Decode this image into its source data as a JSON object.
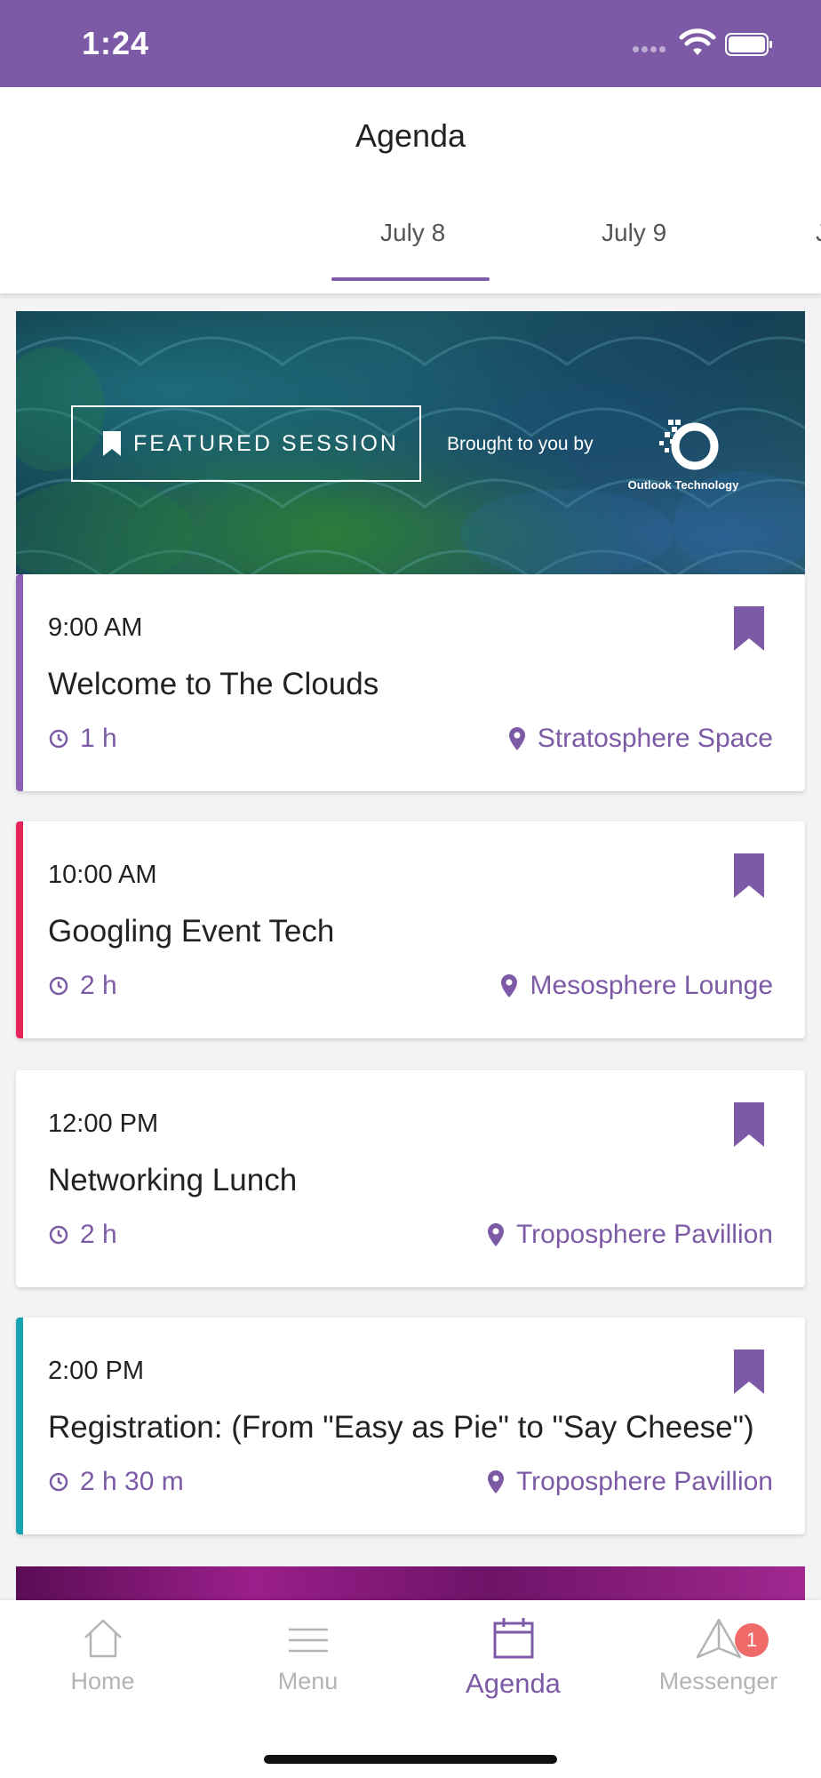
{
  "status_bar": {
    "time": "1:24"
  },
  "header": {
    "title": "Agenda",
    "tabs": [
      {
        "label": "July 8",
        "active": true
      },
      {
        "label": "July 9",
        "active": false
      },
      {
        "label": "J",
        "active": false
      }
    ]
  },
  "featured": {
    "label": "FEATURED SESSION",
    "brought_by": "Brought to you by",
    "sponsor": "Outlook Technology"
  },
  "sessions": [
    {
      "time": "9:00 AM",
      "title": "Welcome to The Clouds",
      "duration": "1 h",
      "location": "Stratosphere Space",
      "stripe_color": "#8b62b6"
    },
    {
      "time": "10:00 AM",
      "title": "Googling Event Tech",
      "duration": "2 h",
      "location": "Mesosphere Lounge",
      "stripe_color": "#e8245a"
    },
    {
      "time": "12:00 PM",
      "title": "Networking Lunch",
      "duration": "2 h",
      "location": "Troposphere Pavillion",
      "stripe_color": "#ffffff"
    },
    {
      "time": "2:00 PM",
      "title": "Registration: (From \"Easy as Pie\" to \"Say Cheese\")",
      "duration": "2 h 30 m",
      "location": "Troposphere Pavillion",
      "stripe_color": "#1aa3b3"
    }
  ],
  "bottom_nav": {
    "items": [
      {
        "label": "Home",
        "icon": "home-icon"
      },
      {
        "label": "Menu",
        "icon": "menu-icon"
      },
      {
        "label": "Agenda",
        "icon": "calendar-icon"
      },
      {
        "label": "Messenger",
        "icon": "messenger-icon"
      }
    ],
    "messenger_badge": "1"
  },
  "colors": {
    "accent": "#7d5aa6",
    "badge": "#f06a6a"
  }
}
